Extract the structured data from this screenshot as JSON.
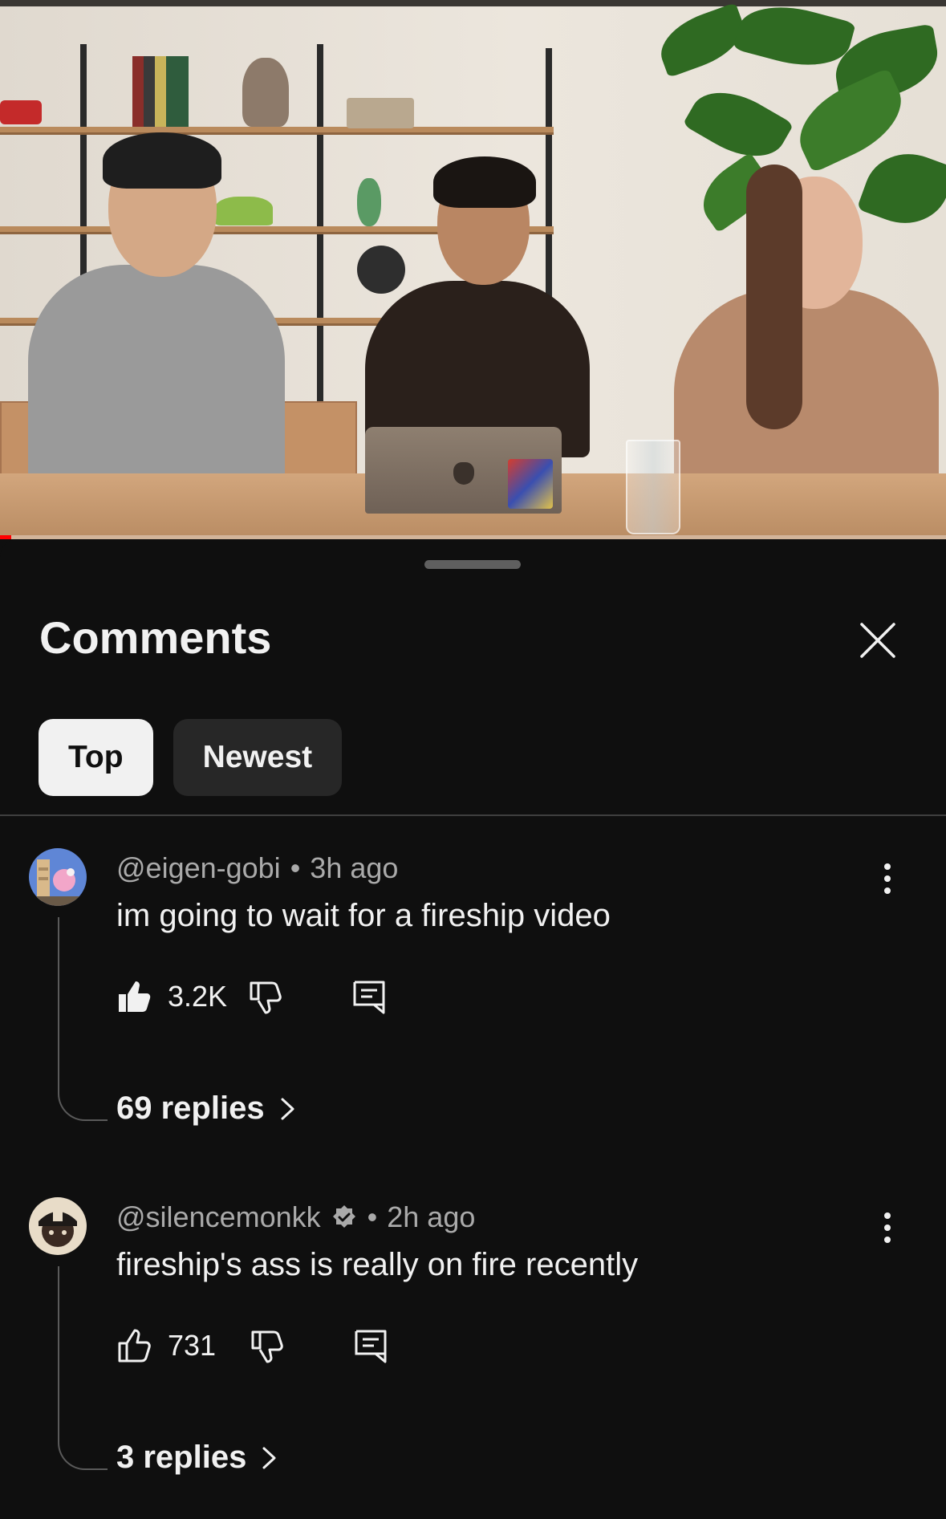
{
  "video": {
    "progress_fraction": 0.012
  },
  "comments_panel": {
    "title": "Comments",
    "close_icon": "close-icon",
    "filters": [
      {
        "label": "Top",
        "selected": true
      },
      {
        "label": "Newest",
        "selected": false
      }
    ]
  },
  "comments": [
    {
      "author": "@eigen-gobi",
      "verified": false,
      "dot": "•",
      "time": "3h ago",
      "text": "im going to wait for a fireship video",
      "likes": "3.2K",
      "liked": true,
      "replies": "69 replies"
    },
    {
      "author": "@silencemonkk",
      "verified": true,
      "dot": "•",
      "time": "2h ago",
      "text": "fireship's ass is really on fire recently",
      "likes": "731",
      "liked": false,
      "replies": "3 replies"
    }
  ],
  "colors": {
    "background": "#0f0f0f",
    "text_primary": "#f1f1f1",
    "text_secondary": "#aaaaaa",
    "chip_active_bg": "#f1f1f1",
    "chip_inactive_bg": "#272727",
    "progress": "#ff0000"
  }
}
